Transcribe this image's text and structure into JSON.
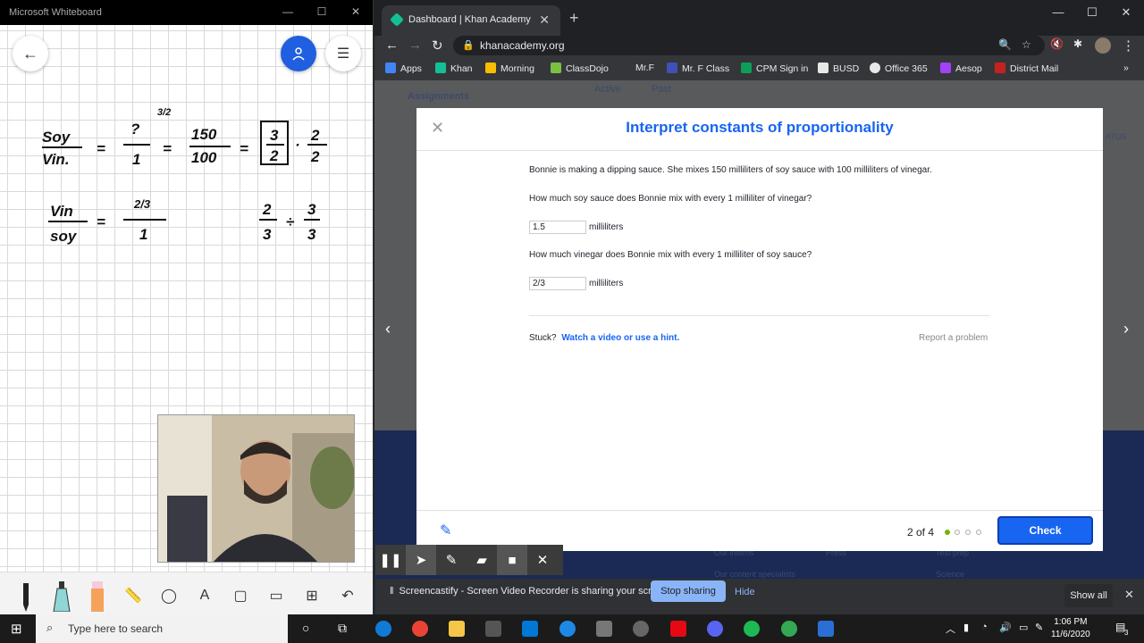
{
  "whiteboard": {
    "window_title": "Microsoft Whiteboard",
    "ink": {
      "top_left_num": "Soy",
      "top_left_den": "Vin.",
      "top_mid_sup": "3/2",
      "top_mid_num": "?",
      "top_mid_den": "1",
      "top_frac_num": "150",
      "top_frac_den": "100",
      "boxed_num": "3",
      "boxed_den": "2",
      "right_num": "2",
      "right_den": "2",
      "bot_left_num": "Vin",
      "bot_left_den": "soy",
      "bot_mid_num": "2/3",
      "bot_mid_den": "1",
      "bot_r1_num": "2",
      "bot_r1_den": "3",
      "bot_r2_num": "3",
      "bot_r2_den": "3",
      "eq": "=",
      "dot_op": "·",
      "div_op": "÷"
    }
  },
  "browser": {
    "tab_title": "Dashboard | Khan Academy",
    "url": "khanacademy.org",
    "bookmarks": [
      "Apps",
      "Khan",
      "Morning",
      "ClassDojo",
      "Mr.F",
      "Mr. F Class",
      "CPM Sign in",
      "BUSD",
      "Office 365",
      "Aesop",
      "District Mail"
    ],
    "bookmarks_more": "»",
    "bg_page": {
      "assignments": "Assignments",
      "tab_active": "Active",
      "tab_past": "Past",
      "status": "ATUS",
      "footer_links": [
        "Our interns",
        "Press",
        "Test prep",
        "Our content specialists",
        "Science"
      ]
    }
  },
  "exercise": {
    "title": "Interpret constants of proportionality",
    "prompt": "Bonnie is making a dipping sauce. She mixes 150 milliliters of soy sauce with 100 milliliters of vinegar.",
    "q1": "How much soy sauce does Bonnie mix with every 1 milliliter of vinegar?",
    "a1": "1.5",
    "q2": "How much vinegar does Bonnie mix with every 1 milliliter of soy sauce?",
    "a2": "2/3",
    "unit": "milliliters",
    "stuck": "Stuck?",
    "hint_link": "Watch a video or use a hint.",
    "report": "Report a problem",
    "progress": "2 of 4",
    "progress_value": 0.5,
    "check": "Check"
  },
  "screencastify": {
    "message": "Screencastify - Screen Video Recorder is sharing your screen.",
    "stop": "Stop sharing",
    "hide": "Hide",
    "show_all": "Show all"
  },
  "taskbar": {
    "search_placeholder": "Type here to search",
    "time": "1:06 PM",
    "date": "11/6/2020",
    "notif_count": "3"
  }
}
